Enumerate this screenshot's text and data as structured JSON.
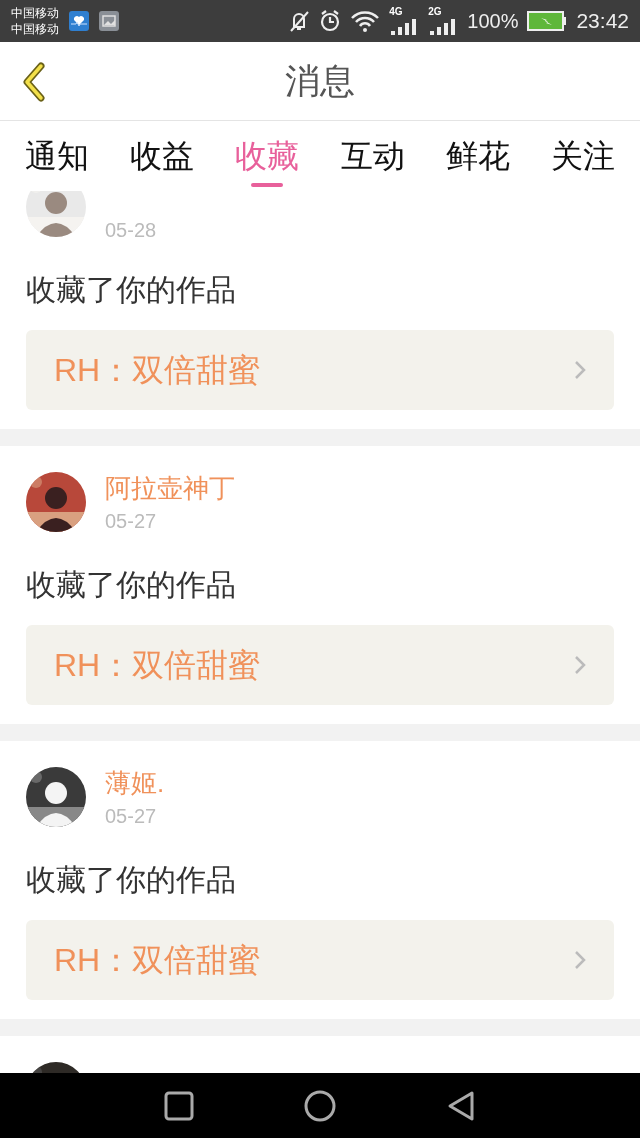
{
  "status_bar": {
    "carriers": [
      "中国移动",
      "中国移动"
    ],
    "battery": "100%",
    "time": "23:42",
    "network_1": "4G",
    "network_2": "2G"
  },
  "header": {
    "title": "消息"
  },
  "tabs": [
    {
      "label": "通知",
      "selected": false
    },
    {
      "label": "收益",
      "selected": false
    },
    {
      "label": "收藏",
      "selected": true
    },
    {
      "label": "互动",
      "selected": false
    },
    {
      "label": "鲜花",
      "selected": false
    },
    {
      "label": "关注",
      "selected": false
    }
  ],
  "messages": [
    {
      "date": "05-28",
      "action": "收藏了你的作品",
      "work": "RH：双倍甜蜜",
      "avatar": {
        "kind": "picture"
      }
    },
    {
      "name": "阿拉壶神丁",
      "date": "05-27",
      "action": "收藏了你的作品",
      "work": "RH：双倍甜蜜",
      "avatar": {
        "kind": "picture"
      }
    },
    {
      "name": "薄姬.",
      "date": "05-27",
      "action": "收藏了你的作品",
      "work": "RH：双倍甜蜜",
      "avatar": {
        "kind": "picture"
      }
    },
    {
      "avatar": {
        "kind": "picture"
      }
    }
  ]
}
